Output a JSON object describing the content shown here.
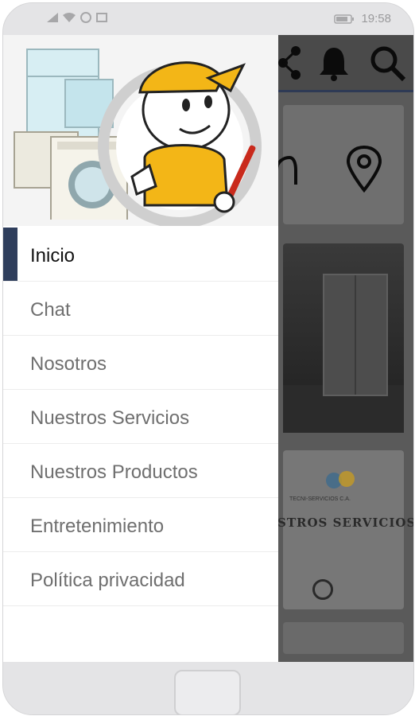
{
  "status_bar": {
    "time": "19:58",
    "icons": [
      "signal-icon",
      "wifi-icon",
      "whatsapp-icon",
      "battery-icon"
    ]
  },
  "background_app": {
    "toolbar_icons": [
      "share-icon",
      "bell-icon",
      "search-icon"
    ],
    "card_icons": [
      "location-pin-icon"
    ],
    "services_card_text": "STROS SERVICIOS",
    "services_logo_text": "TECNI-SERVICIOS C.A."
  },
  "drawer": {
    "header_image": "technician-with-appliances-illustration",
    "menu": [
      {
        "label": "Inicio",
        "active": true
      },
      {
        "label": "Chat",
        "active": false
      },
      {
        "label": "Nosotros",
        "active": false
      },
      {
        "label": "Nuestros Servicios",
        "active": false
      },
      {
        "label": "Nuestros Productos",
        "active": false
      },
      {
        "label": "Entretenimiento",
        "active": false
      },
      {
        "label": "Política privacidad",
        "active": false
      }
    ]
  },
  "colors": {
    "active_indicator": "#2f3e5c",
    "mascot_yellow": "#f3b617",
    "scrim": "#5a5a5a"
  }
}
